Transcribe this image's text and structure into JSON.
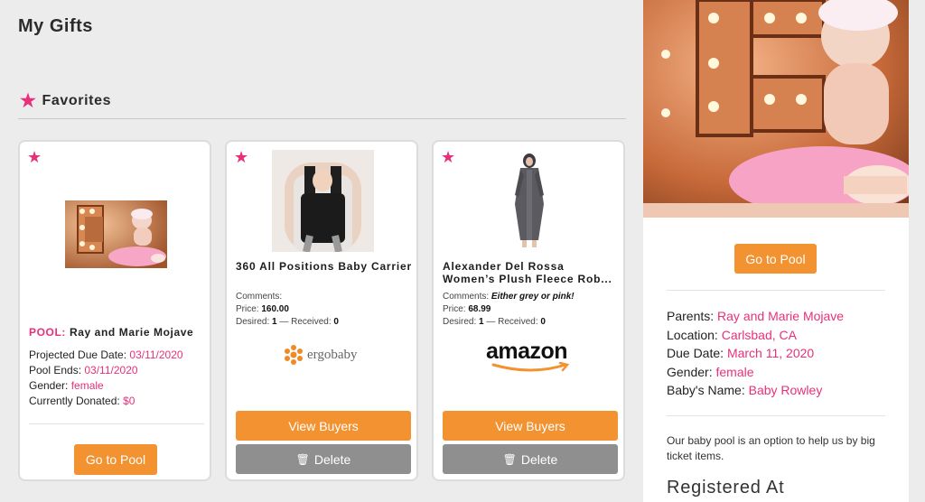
{
  "page_title": "My Gifts",
  "section": {
    "title": "Favorites",
    "icon": "star-icon"
  },
  "colors": {
    "accent_pink": "#e8307a",
    "button_orange": "#f39230",
    "button_grey": "#8f8f8f"
  },
  "pool_card": {
    "pool_label": "POOL:",
    "pool_name": "Ray and Marie Mojave",
    "rows": [
      {
        "label": "Projected Due Date: ",
        "value": "03/11/2020"
      },
      {
        "label": "Pool Ends: ",
        "value": "03/11/2020"
      },
      {
        "label": "Gender: ",
        "value": "female"
      },
      {
        "label": "Currently Donated: ",
        "value": "$0"
      }
    ],
    "button": "Go to Pool"
  },
  "gifts": [
    {
      "title": "360 All Positions Baby Carrier",
      "comments_label": "Comments:",
      "comments": "",
      "price_label": "Price: ",
      "price": "160.00",
      "desired_label": "Desired: ",
      "desired": "1",
      "received_label": " — Received: ",
      "received": "0",
      "store": "ergobaby",
      "view_button": "View Buyers",
      "delete_button": "Delete"
    },
    {
      "title": "Alexander Del Rossa Women’s Plush Fleece Rob...",
      "comments_label": "Comments: ",
      "comments": "Either grey or pink!",
      "price_label": "Price: ",
      "price": "68.99",
      "desired_label": "Desired: ",
      "desired": "1",
      "received_label": " — Received: ",
      "received": "0",
      "store": "amazon",
      "view_button": "View Buyers",
      "delete_button": "Delete"
    }
  ],
  "sidebar": {
    "button": "Go to Pool",
    "info": [
      {
        "label": "Parents: ",
        "value": "Ray and Marie Mojave"
      },
      {
        "label": "Location: ",
        "value": "Carlsbad, CA"
      },
      {
        "label": "Due Date: ",
        "value": "March 11, 2020"
      },
      {
        "label": "Gender: ",
        "value": "female"
      },
      {
        "label": "Baby's Name: ",
        "value": "Baby Rowley"
      }
    ],
    "description": "Our baby pool is an option to help us by big ticket items.",
    "registered_heading": "Registered At"
  }
}
